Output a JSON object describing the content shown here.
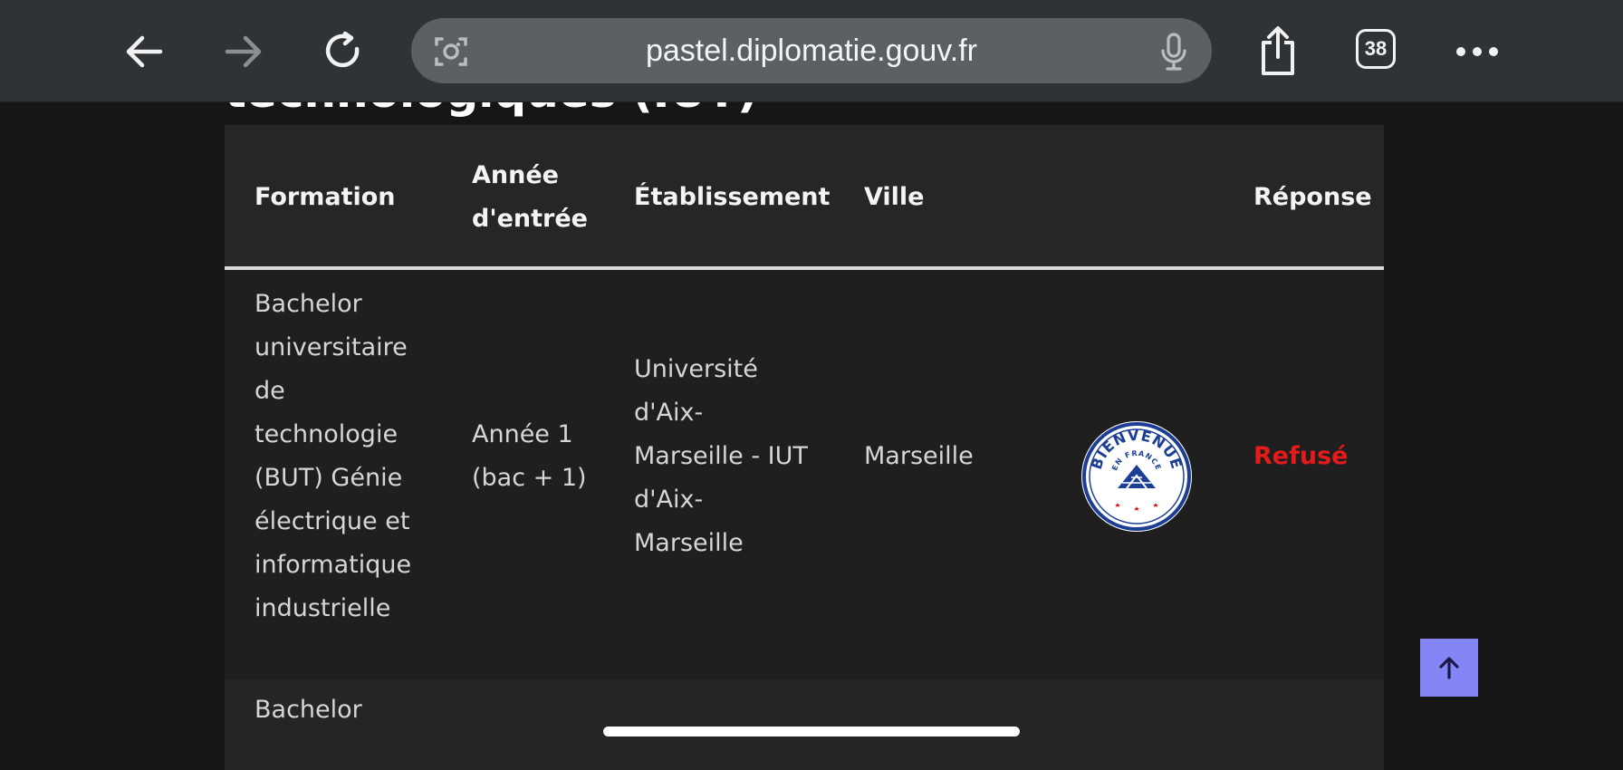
{
  "browser": {
    "url": "pastel.diplomatie.gouv.fr",
    "tab_count": "38",
    "icons": {
      "back": "arrow-left-icon",
      "forward": "arrow-right-icon",
      "reload": "reload-icon",
      "lens": "visual-search-icon",
      "mic": "microphone-icon",
      "share": "share-icon",
      "tabs": "tabs-icon",
      "more": "more-icon"
    }
  },
  "page": {
    "heading": "technologiques (IUT)"
  },
  "table": {
    "headers": {
      "formation": "Formation",
      "annee_line1": "Année",
      "annee_line2": "d'entrée",
      "etablissement": "Établissement",
      "ville": "Ville",
      "reponse": "Réponse"
    },
    "rows": [
      {
        "formation_lines": [
          "Bachelor",
          "universitaire",
          "de",
          "technologie",
          "(BUT) Génie",
          "électrique et",
          "informatique",
          "industrielle"
        ],
        "annee_lines": [
          "Année 1",
          "(bac + 1)"
        ],
        "etablissement_lines": [
          "Université",
          "d'Aix-",
          "Marseille - IUT",
          "d'Aix-",
          "Marseille"
        ],
        "ville": "Marseille",
        "label_badge": {
          "text_top": "BIENVENUE",
          "text_middle": "EN FRANCE",
          "colors": {
            "blue": "#1c3f95",
            "red": "#e1000f"
          }
        },
        "reponse": "Refusé"
      },
      {
        "formation_first_line": "Bachelor"
      }
    ]
  },
  "controls": {
    "scroll_top_icon": "arrow-up-icon"
  },
  "colors": {
    "chrome": "#2f3336",
    "urlbar": "#5b6064",
    "page_bg": "#161616",
    "table_bg": "#1f1f1f",
    "refused": "#e51a1a",
    "scroll_top": "#8585f6"
  }
}
